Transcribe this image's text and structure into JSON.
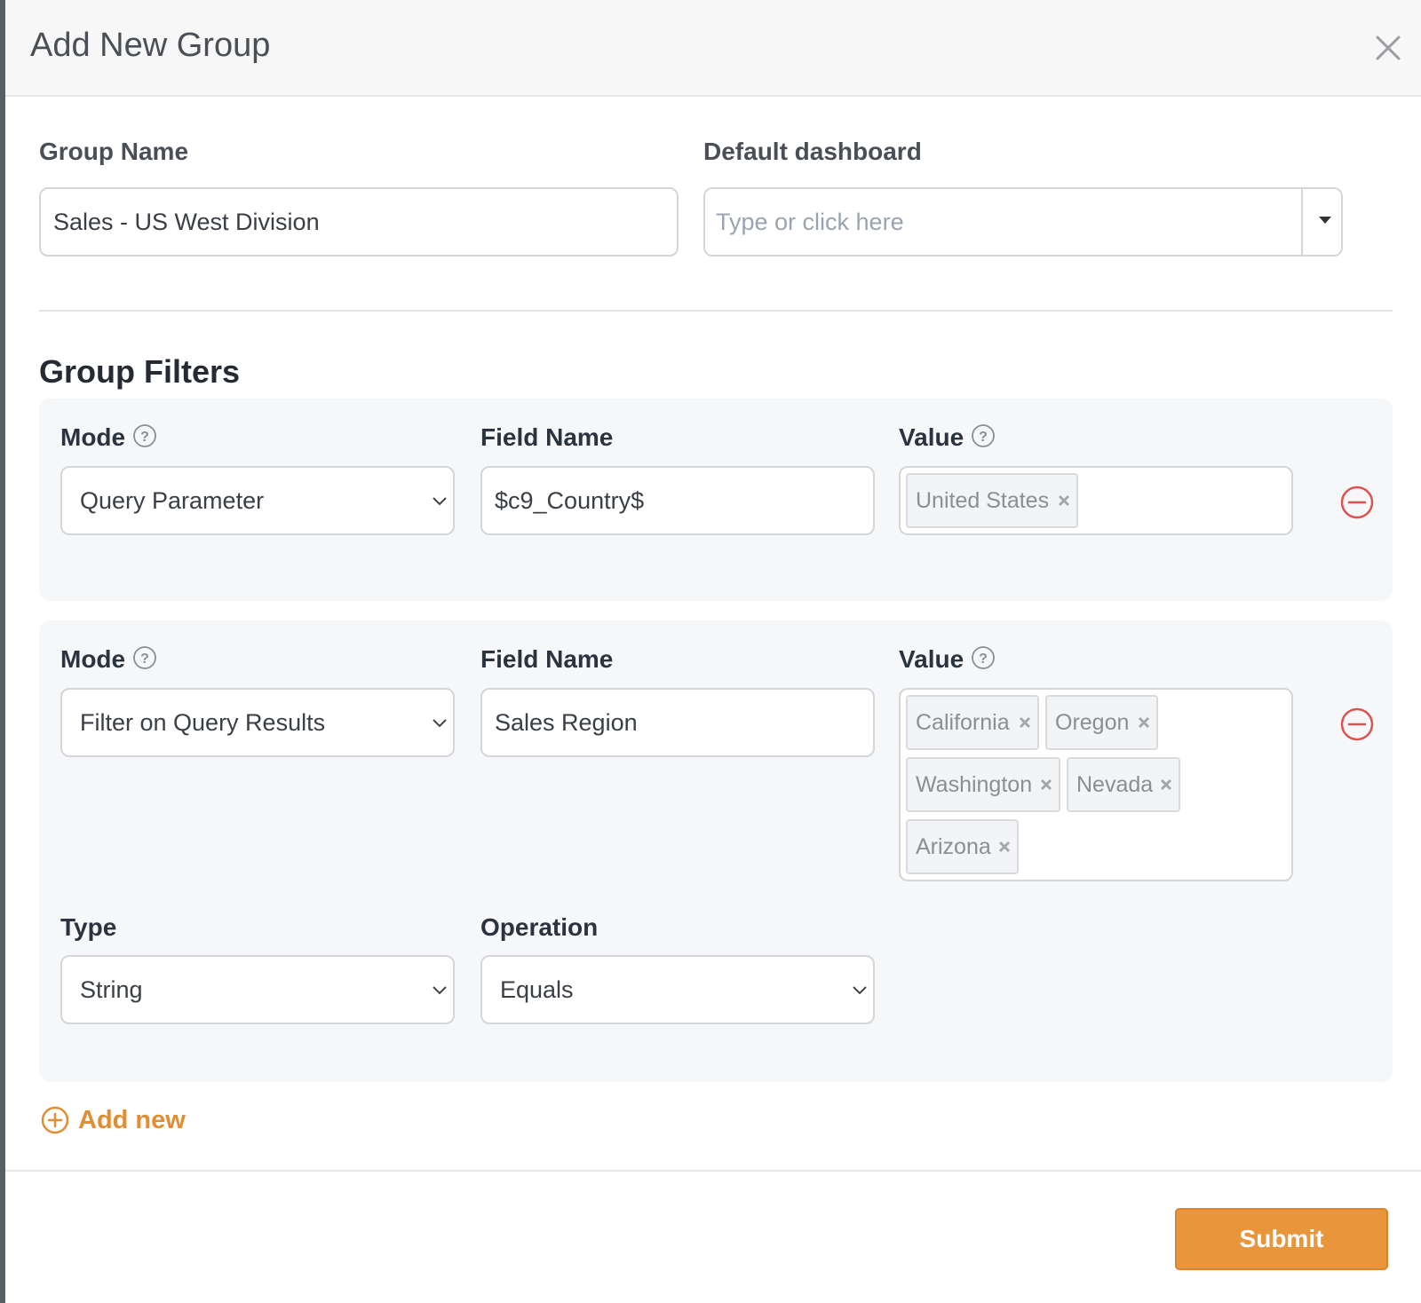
{
  "modal": {
    "title": "Add New Group"
  },
  "group_name": {
    "label": "Group Name",
    "value": "Sales - US West Division"
  },
  "default_dashboard": {
    "label": "Default dashboard",
    "placeholder": "Type or click here"
  },
  "group_filters": {
    "title": "Group Filters",
    "filters": [
      {
        "mode_label": "Mode",
        "mode_value": "Query Parameter",
        "field_label": "Field Name",
        "field_value": "$c9_Country$",
        "value_label": "Value",
        "values": [
          "United States"
        ]
      },
      {
        "mode_label": "Mode",
        "mode_value": "Filter on Query Results",
        "field_label": "Field Name",
        "field_value": "Sales Region",
        "value_label": "Value",
        "values": [
          "California",
          "Oregon",
          "Washington",
          "Nevada",
          "Arizona"
        ],
        "type_label": "Type",
        "type_value": "String",
        "operation_label": "Operation",
        "operation_value": "Equals"
      }
    ],
    "add_new_label": "Add new"
  },
  "footer": {
    "submit_label": "Submit"
  },
  "colors": {
    "accent": "#e8953c",
    "remove": "#d9534f",
    "card_bg": "#f6f7f9"
  },
  "icons": {
    "close": "close-icon",
    "help": "question-circle-icon",
    "remove": "minus-circle-icon",
    "add": "plus-circle-icon",
    "tag_remove": "x-icon",
    "chevron": "chevron-down-icon",
    "caret": "caret-down-icon"
  }
}
